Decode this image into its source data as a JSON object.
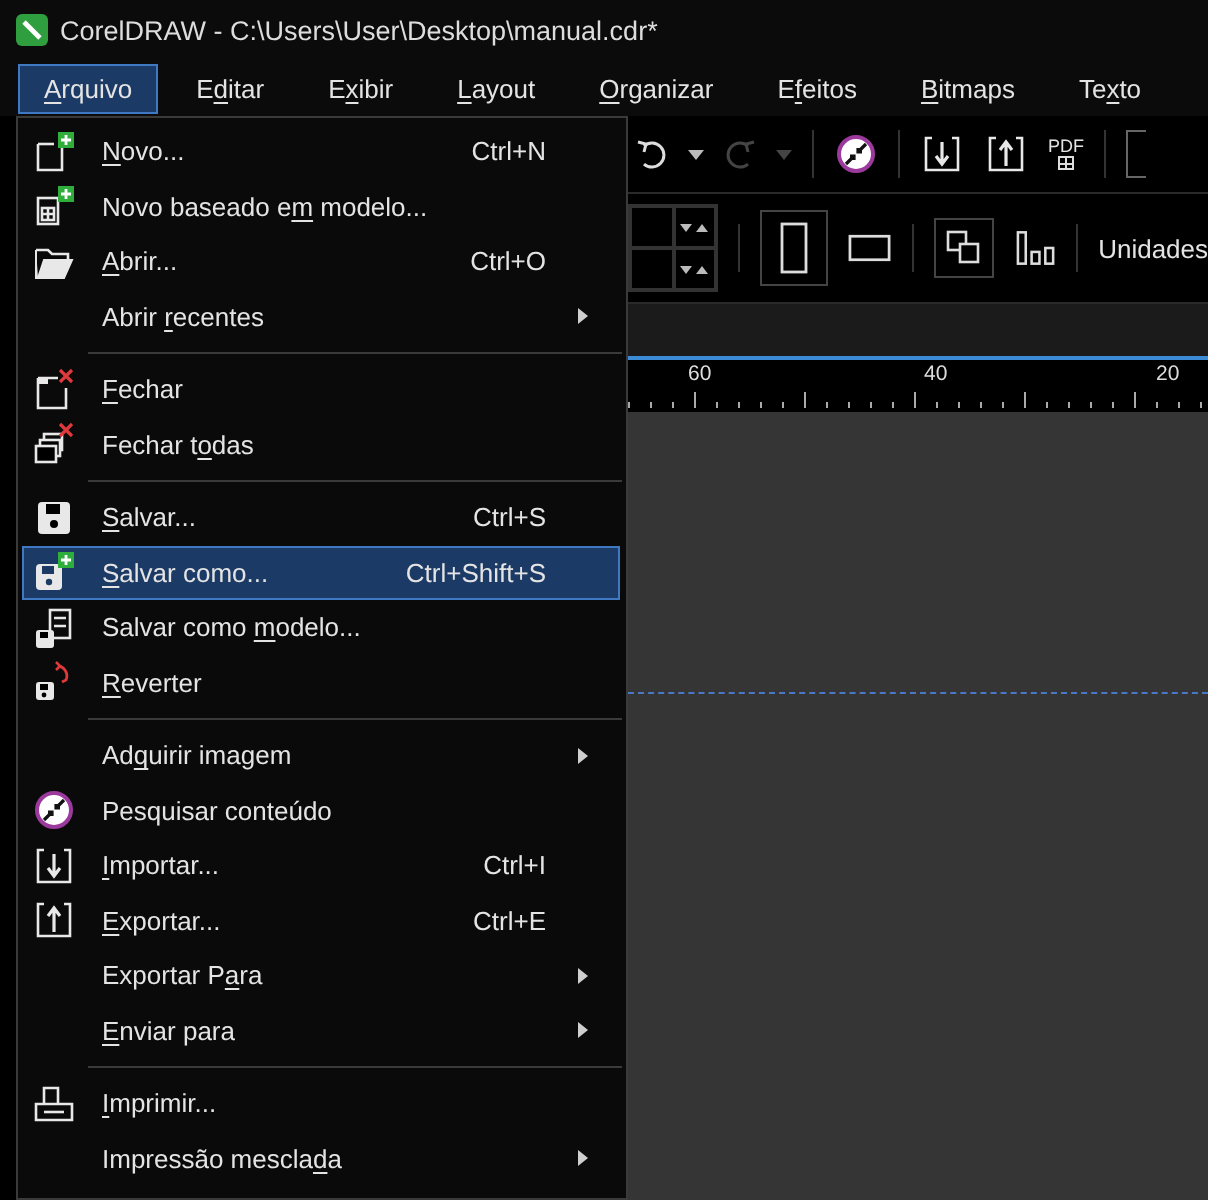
{
  "window": {
    "title": "CorelDRAW - C:\\Users\\User\\Desktop\\manual.cdr*"
  },
  "menubar": [
    {
      "label": {
        "key": "A",
        "post": "rquivo"
      },
      "selected": true
    },
    {
      "label": {
        "pre": "E",
        "key": "d",
        "post": "itar"
      },
      "selected": false
    },
    {
      "label": {
        "pre": "E",
        "key": "x",
        "post": "ibir"
      },
      "selected": false
    },
    {
      "label": {
        "key": "L",
        "post": "ayout"
      },
      "selected": false
    },
    {
      "label": {
        "key": "O",
        "post": "rganizar"
      },
      "selected": false
    },
    {
      "label": {
        "pre": "E",
        "key": "f",
        "post": "eitos"
      },
      "selected": false
    },
    {
      "label": {
        "key": "B",
        "post": "itmaps"
      },
      "selected": false
    },
    {
      "label": {
        "pre": "Te",
        "key": "x",
        "post": "to"
      },
      "selected": false
    }
  ],
  "file_menu": [
    {
      "kind": "command",
      "label": {
        "key": "N",
        "post": "ovo..."
      },
      "shortcut": "Ctrl+N",
      "submenu": false,
      "selected": false
    },
    {
      "kind": "command",
      "label": {
        "pre": "Novo baseado e",
        "key": "m",
        "post": " modelo..."
      },
      "submenu": false,
      "selected": false
    },
    {
      "kind": "command",
      "label": {
        "key": "A",
        "post": "brir..."
      },
      "shortcut": "Ctrl+O",
      "submenu": false,
      "selected": false
    },
    {
      "kind": "command",
      "label": {
        "pre": "Abrir ",
        "key": "r",
        "post": "ecentes"
      },
      "submenu": true,
      "selected": false
    },
    {
      "kind": "separator"
    },
    {
      "kind": "command",
      "label": {
        "key": "F",
        "post": "echar"
      },
      "submenu": false,
      "selected": false
    },
    {
      "kind": "command",
      "label": {
        "pre": "Fechar t",
        "key": "o",
        "post": "das"
      },
      "submenu": false,
      "selected": false
    },
    {
      "kind": "separator"
    },
    {
      "kind": "command",
      "label": {
        "key": "S",
        "post": "alvar..."
      },
      "shortcut": "Ctrl+S",
      "submenu": false,
      "selected": false
    },
    {
      "kind": "command",
      "label": {
        "key": "S",
        "post": "alvar como..."
      },
      "shortcut": "Ctrl+Shift+S",
      "submenu": false,
      "selected": true
    },
    {
      "kind": "command",
      "label": {
        "pre": "Salvar como ",
        "key": "m",
        "post": "odelo..."
      },
      "submenu": false,
      "selected": false
    },
    {
      "kind": "command",
      "label": {
        "key": "R",
        "post": "everter"
      },
      "submenu": false,
      "selected": false
    },
    {
      "kind": "separator"
    },
    {
      "kind": "command",
      "label": {
        "pre": "Ad",
        "key": "q",
        "post": "uirir imagem"
      },
      "submenu": true,
      "selected": false
    },
    {
      "kind": "command",
      "label": {
        "pre": "Pesquisar conteúdo"
      },
      "submenu": false,
      "selected": false
    },
    {
      "kind": "command",
      "label": {
        "key": "I",
        "post": "mportar..."
      },
      "shortcut": "Ctrl+I",
      "submenu": false,
      "selected": false
    },
    {
      "kind": "command",
      "label": {
        "key": "E",
        "post": "xportar..."
      },
      "shortcut": "Ctrl+E",
      "submenu": false,
      "selected": false
    },
    {
      "kind": "command",
      "label": {
        "pre": "Exportar P",
        "key": "a",
        "post": "ra"
      },
      "submenu": true,
      "selected": false
    },
    {
      "kind": "command",
      "label": {
        "key": "E",
        "post": "nviar para"
      },
      "submenu": true,
      "selected": false
    },
    {
      "kind": "separator"
    },
    {
      "kind": "command",
      "label": {
        "key": "I",
        "post": "mprimir..."
      },
      "submenu": false,
      "selected": false
    },
    {
      "kind": "command",
      "label": {
        "pre": "Impressão mescla",
        "key": "d",
        "post": "a"
      },
      "submenu": true,
      "selected": false
    }
  ],
  "toolbar": {
    "pdf_label": "PDF",
    "units_label": "Unidades"
  },
  "ruler": {
    "labels": [
      "60",
      "40",
      "20"
    ]
  }
}
